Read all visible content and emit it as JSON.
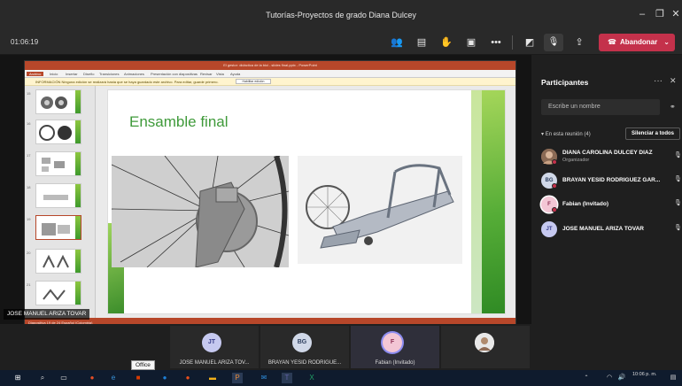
{
  "window": {
    "title": "Tutorías-Proyectos de grado Diana Dulcey"
  },
  "toolbar": {
    "timer": "01:06:19",
    "leave_label": "Abandonar"
  },
  "shared_screen": {
    "app_title": "El gestor: didáctica de la bici - slides final.pptx - PowerPoint",
    "ribbon_tabs": [
      "Archivo",
      "Inicio",
      "Insertar",
      "Diseño",
      "Transiciones",
      "Animaciones",
      "Presentación con diapositivas",
      "Revisar",
      "Vista",
      "Ayuda"
    ],
    "message_bar": "INFORMACIÓN  Ninguna edición se realizará hasta que se haya guardado este archivo. Para editar, guarde primero.",
    "message_button": "Habilitar edición",
    "slide_numbers": [
      "15",
      "16",
      "17",
      "18",
      "19",
      "20",
      "21"
    ],
    "slide_title": "Ensamble final",
    "status_text": "Diapositiva 19 de 24   Español (Colombia)",
    "presenter_name": "JOSE MANUEL ARIZA TOVAR"
  },
  "participants": {
    "header": "Participantes",
    "search_placeholder": "Escribe un nombre",
    "section_label": "En esta reunión (4)",
    "mute_all_label": "Silenciar a todos",
    "people": [
      {
        "initials": "",
        "name": "DIANA CAROLINA DULCEY DIAZ",
        "role": "Organizador",
        "color": "#8a6a55"
      },
      {
        "initials": "BG",
        "name": "BRAYAN YESID RODRIGUEZ GAR...",
        "role": "",
        "color": "#d0d8e8"
      },
      {
        "initials": "F",
        "name": "Fabian (Invitado)",
        "role": "",
        "color": "#f3c6d5"
      },
      {
        "initials": "JT",
        "name": "JOSE MANUEL ARIZA TOVAR",
        "role": "",
        "color": "#c6c9f0"
      }
    ]
  },
  "video_strip": [
    {
      "initials": "JT",
      "name": "JOSE MANUEL ARIZA TOV...",
      "color": "#c6c9f0"
    },
    {
      "initials": "BG",
      "name": "BRAYAN YESID RODRIGUE...",
      "color": "#d0d8e8"
    },
    {
      "initials": "F",
      "name": "Fabian (Invitado)",
      "color": "#f3c6d5"
    },
    {
      "initials": "",
      "name": "",
      "color": "#e8e8e8"
    }
  ],
  "tooltip": "Office",
  "taskbar": {
    "time": "10:06 p. m.",
    "date": ""
  },
  "colors": {
    "accent_red": "#c4314b",
    "teams_dark": "#292929",
    "slide_green": "#3f9a3a",
    "ppt_red": "#b7472a"
  }
}
